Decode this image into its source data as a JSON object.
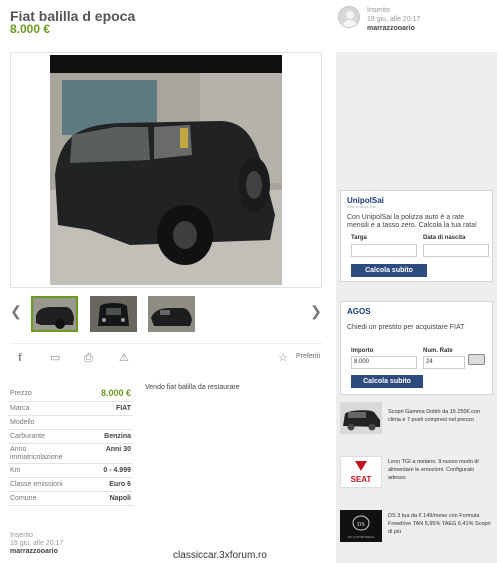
{
  "listing": {
    "title": "Fiat balilla d epoca",
    "price": "8.000 €",
    "seller": {
      "label": "Inserito",
      "date": "19 giu, alle 20:17",
      "username": "marrazzooario"
    },
    "description": "Vendo fiat balilla da restaurare"
  },
  "gallery": {
    "prev_icon": "chevron-left-icon",
    "next_icon": "chevron-right-icon",
    "prev_glyph": "❮",
    "next_glyph": "❯",
    "active_thumb": 0,
    "thumb_count": 3
  },
  "actions": {
    "icons": [
      "facebook-icon",
      "message-icon",
      "print-icon",
      "warning-icon",
      "star-icon"
    ],
    "facebook": "f",
    "message": "▭",
    "print": "⎙",
    "report": "⚠",
    "star": "☆",
    "favorite_label": "Preferiti"
  },
  "specs": [
    {
      "key": "Prezzo",
      "value": "8.000 €"
    },
    {
      "key": "Marca",
      "value": "FIAT"
    },
    {
      "key": "Modello",
      "value": ""
    },
    {
      "key": "Carburante",
      "value": "Benzina"
    },
    {
      "key": "Anno\nimmatricolazione",
      "value": "Anni 30"
    },
    {
      "key": "Km",
      "value": "0 - 4.999"
    },
    {
      "key": "Classe emissioni",
      "value": "Euro 6"
    },
    {
      "key": "Comune",
      "value": "Napoli"
    }
  ],
  "ads": {
    "unipol": {
      "brand": "UnipolSai",
      "sub": "ASSICURAZIONI",
      "text": "Con UnipolSai la polizza auto è a rate mensili e a tasso zero. Calcola la tua rata!",
      "field1_label": "Targa",
      "field2_label": "Data di nascita",
      "button": "Calcola subito"
    },
    "agos": {
      "brand": "AGOS",
      "text": "Chiedi un prestito per acquistare FIAT",
      "amount_label": "Importo",
      "amount_value": "8.000",
      "rate_label": "Num. Rate",
      "rate_value": "24",
      "button": "Calcola subito",
      "calc_icon": "calculator-icon"
    },
    "promos": [
      {
        "text": "Scopri Gamma Doblò da 15.250€ con clima e 7 posti compresi nel prezzo"
      },
      {
        "text": "Leon TGI a metano. Il nuovo modo di alimentare le emozioni. Configuralo adesso",
        "logo": "SEAT"
      },
      {
        "text": "DS 3 tua da € 149/mese con Formula Freedrive TAN 5,95% TAEG 6,41% Scopri di più",
        "logo": "DS AUTOMOBILES"
      }
    ]
  },
  "watermark": "classiccar.3xforum.ro",
  "colors": {
    "accent": "#6a9a1f",
    "button": "#2d4b7f",
    "sidebar": "#eeeeee"
  }
}
